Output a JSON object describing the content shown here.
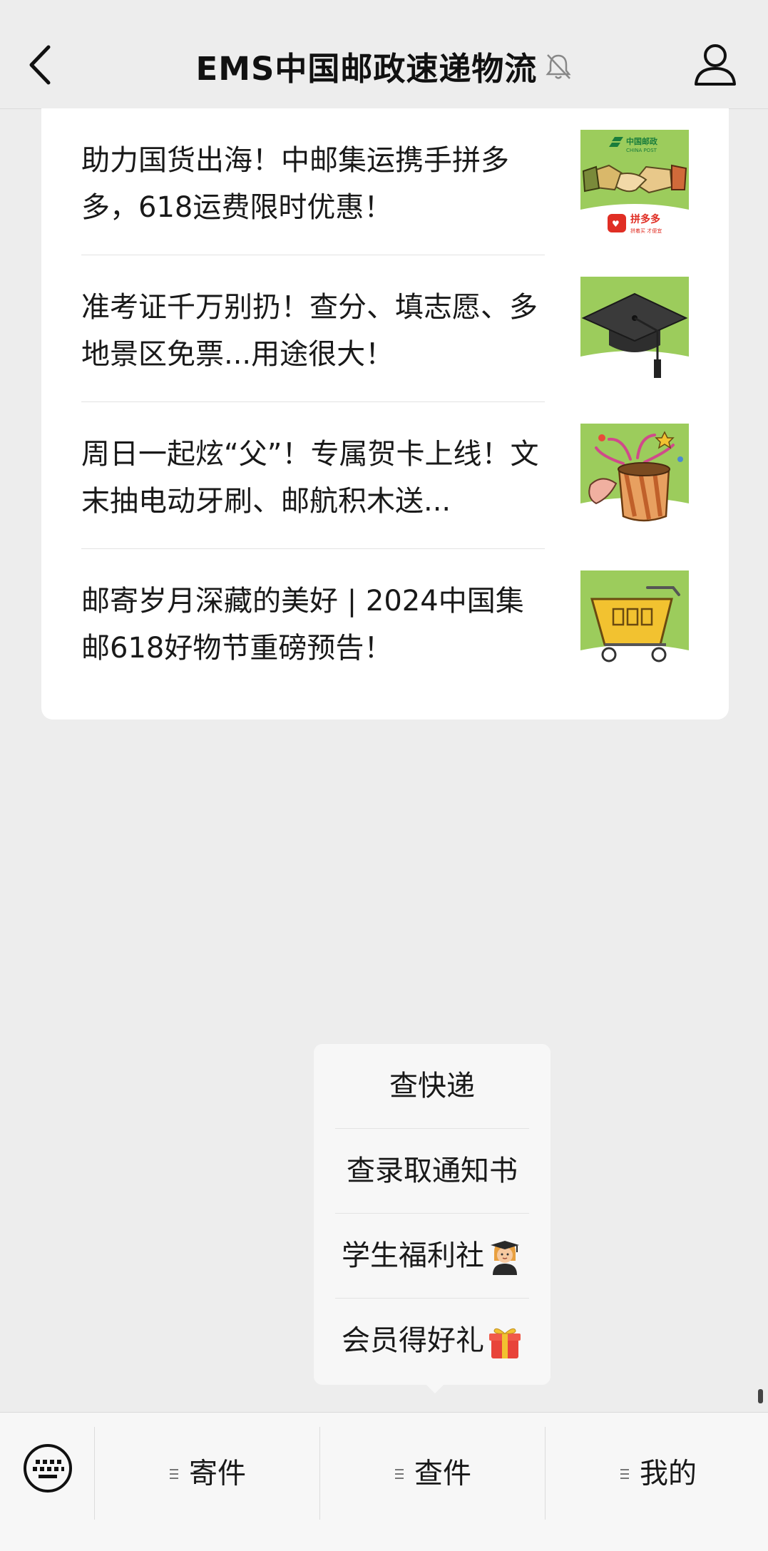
{
  "header": {
    "title": "EMS中国邮政速递物流",
    "icons": {
      "back": "chevron-left-icon",
      "mute": "bell-muted-icon",
      "profile": "user-icon"
    }
  },
  "articles": [
    {
      "headline": "助力国货出海！中邮集运携手拼多多，618运费限时优惠！",
      "thumb_icon": "handshake-chinapost-pinduoduo-image",
      "thumb_text": {
        "brand_cn": "中国邮政",
        "brand_en": "CHINA POST",
        "partner": "拼多多",
        "partner_sub": "拼着买 才便宜"
      }
    },
    {
      "headline": "准考证千万别扔！查分、填志愿、多地景区免票...用途很大！",
      "thumb_icon": "graduation-cap-image"
    },
    {
      "headline": "周日一起炫“父”！专属贺卡上线！文末抽电动牙刷、邮航积木送...",
      "thumb_icon": "gift-box-image"
    },
    {
      "headline": "邮寄岁月深藏的美好 | 2024中国集邮618好物节重磅预告！",
      "thumb_icon": "shopping-cart-image"
    }
  ],
  "popup_menu": {
    "items": [
      {
        "label": "查快递",
        "emoji": ""
      },
      {
        "label": "查录取通知书",
        "emoji": ""
      },
      {
        "label": "学生福利社",
        "emoji": "student-emoji-icon"
      },
      {
        "label": "会员得好礼",
        "emoji": "gift-emoji-icon"
      }
    ]
  },
  "bottom_menu": {
    "keyboard_icon": "keyboard-icon",
    "tabs": [
      {
        "label": "寄件"
      },
      {
        "label": "查件"
      },
      {
        "label": "我的"
      }
    ]
  },
  "colors": {
    "background": "#ededed",
    "card": "#ffffff",
    "thumb_green": "#9ccc5c",
    "text": "#191919"
  }
}
